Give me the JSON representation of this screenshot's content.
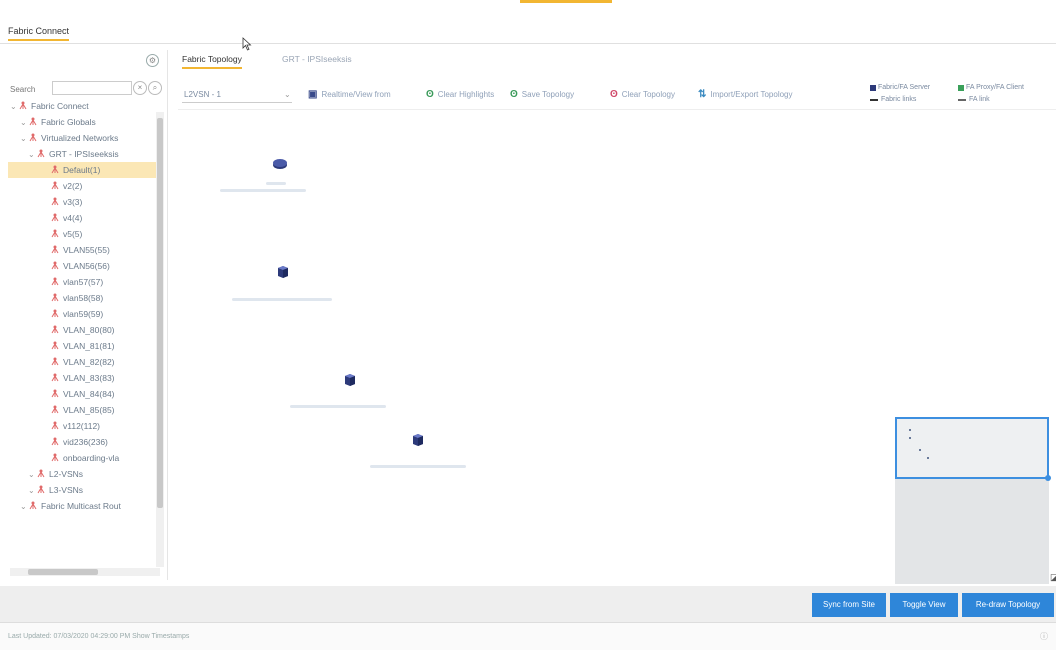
{
  "app": {
    "tab_label": "Fabric Connect"
  },
  "tree": {
    "search_label": "Search",
    "search_value": "",
    "items": [
      {
        "label": "Fabric Connect",
        "level": 0,
        "type": "root"
      },
      {
        "label": "Fabric Globals",
        "level": 1,
        "type": "folder"
      },
      {
        "label": "Virtualized Networks",
        "level": 1,
        "type": "folder"
      },
      {
        "label": "GRT - IPSIseeksis",
        "level": 2,
        "type": "folder"
      },
      {
        "label": "Default(1)",
        "level": 3,
        "type": "vlan",
        "selected": true
      },
      {
        "label": "v2(2)",
        "level": 3,
        "type": "vlan"
      },
      {
        "label": "v3(3)",
        "level": 3,
        "type": "vlan"
      },
      {
        "label": "v4(4)",
        "level": 3,
        "type": "vlan"
      },
      {
        "label": "v5(5)",
        "level": 3,
        "type": "vlan"
      },
      {
        "label": "VLAN55(55)",
        "level": 3,
        "type": "vlan"
      },
      {
        "label": "VLAN56(56)",
        "level": 3,
        "type": "vlan"
      },
      {
        "label": "vlan57(57)",
        "level": 3,
        "type": "vlan"
      },
      {
        "label": "vlan58(58)",
        "level": 3,
        "type": "vlan"
      },
      {
        "label": "vlan59(59)",
        "level": 3,
        "type": "vlan"
      },
      {
        "label": "VLAN_80(80)",
        "level": 3,
        "type": "vlan"
      },
      {
        "label": "VLAN_81(81)",
        "level": 3,
        "type": "vlan"
      },
      {
        "label": "VLAN_82(82)",
        "level": 3,
        "type": "vlan"
      },
      {
        "label": "VLAN_83(83)",
        "level": 3,
        "type": "vlan"
      },
      {
        "label": "VLAN_84(84)",
        "level": 3,
        "type": "vlan"
      },
      {
        "label": "VLAN_85(85)",
        "level": 3,
        "type": "vlan"
      },
      {
        "label": "v112(112)",
        "level": 3,
        "type": "vlan"
      },
      {
        "label": "vid236(236)",
        "level": 3,
        "type": "vlan"
      },
      {
        "label": "onboarding-vla",
        "level": 3,
        "type": "vlan"
      },
      {
        "label": "L2-VSNs",
        "level": 2,
        "type": "folder"
      },
      {
        "label": "L3-VSNs",
        "level": 2,
        "type": "folder"
      },
      {
        "label": "Fabric Multicast Rout",
        "level": 1,
        "type": "folder"
      }
    ]
  },
  "topology_tabs": [
    {
      "label": "Fabric Topology",
      "active": true
    },
    {
      "label": "GRT - IPSIseeksis",
      "active": false
    }
  ],
  "toolbar": {
    "scope_value": "L2VSN - 1",
    "buttons": [
      {
        "label": "Realtime/View from",
        "icon": "monitor-icon"
      },
      {
        "label": "Clear Highlights",
        "icon": "clear-highlights-icon"
      },
      {
        "label": "Save Topology",
        "icon": "save-topology-icon"
      },
      {
        "label": "Clear Topology",
        "icon": "clear-topology-icon"
      },
      {
        "label": "Import/Export Topology",
        "icon": "import-export-icon"
      }
    ]
  },
  "legend": {
    "items": [
      {
        "label": "Fabric/FA Server",
        "color": "#2d3a7a"
      },
      {
        "label": "FA Proxy/FA Client",
        "color": "#3aa05a"
      },
      {
        "label": "Fabric links",
        "color": "#333333"
      },
      {
        "label": "FA link",
        "color": "#333333"
      }
    ]
  },
  "actions": {
    "sync": "Sync from Site",
    "toggle": "Toggle View",
    "redraw": "Re-draw Topology"
  },
  "status": {
    "text": "Last Updated: 07/03/2020 04:29:00 PM   Show Timestamps"
  },
  "colors": {
    "accent": "#f2b632",
    "button": "#2e86d9",
    "node": "#2d3a7a",
    "tree_icon": "#e06a6a"
  }
}
